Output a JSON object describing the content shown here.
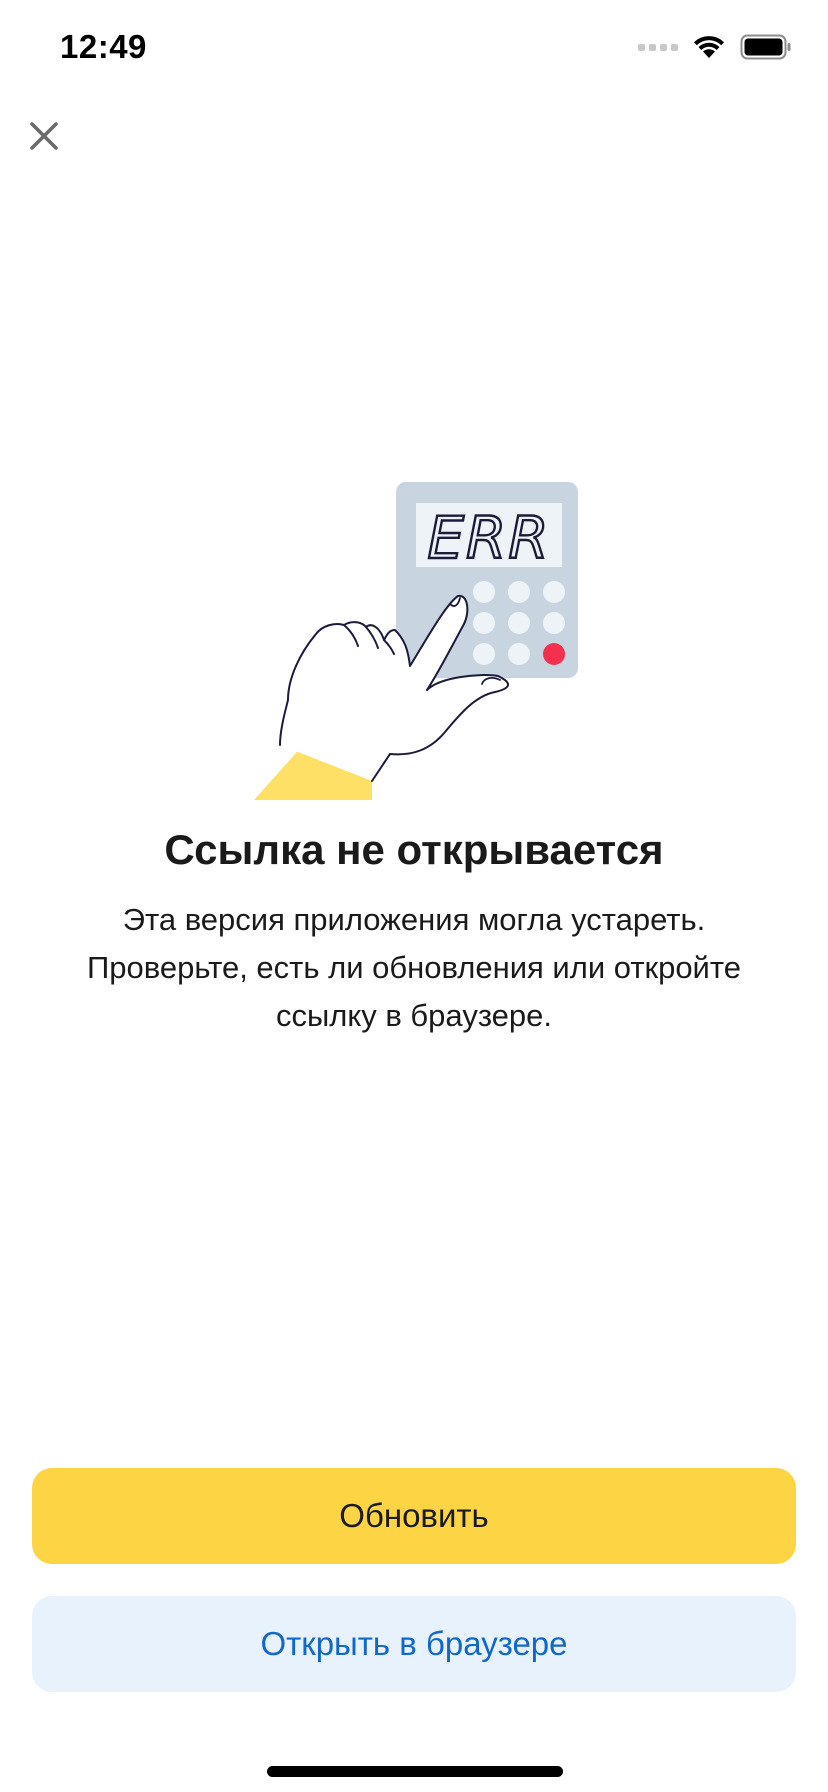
{
  "status_bar": {
    "time": "12:49"
  },
  "illustration": {
    "display_text": "ERR"
  },
  "content": {
    "title": "Ссылка не открывается",
    "message_lines": [
      "Эта версия приложения могла устареть.",
      "Проверьте, есть ли обновления или откройте",
      "ссылку в браузере."
    ]
  },
  "actions": {
    "update_label": "Обновить",
    "open_browser_label": "Открыть в браузере"
  },
  "colors": {
    "primary_button": "#fdd443",
    "secondary_button": "#e8f2fc",
    "secondary_text": "#1168c9",
    "calculator_body": "#c8d5e1",
    "error_key": "#f4304f",
    "sleeve": "#fde065"
  }
}
